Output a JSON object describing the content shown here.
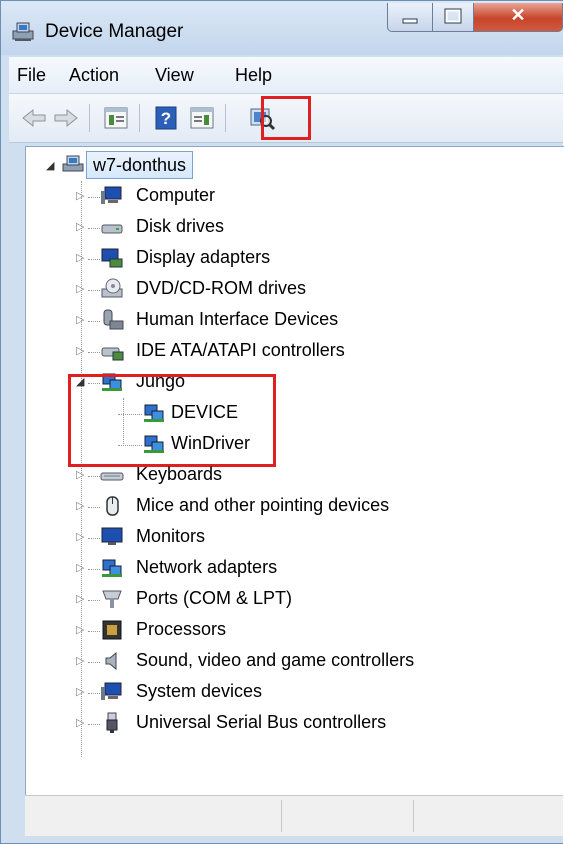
{
  "window": {
    "title": "Device Manager"
  },
  "title_controls": {
    "minimize": "minimize",
    "maximize": "maximize",
    "close": "close"
  },
  "menu": [
    "File",
    "Action",
    "View",
    "Help"
  ],
  "toolbar": [
    "back-arrow-icon",
    "forward-arrow-icon",
    "properties-icon",
    "help-icon",
    "show-hide-icon",
    "scan-hardware-icon"
  ],
  "tree": {
    "root": "w7-donthus",
    "items": [
      {
        "label": "Computer",
        "icon": "computer-icon",
        "expanded": false
      },
      {
        "label": "Disk drives",
        "icon": "disk-drive-icon",
        "expanded": false
      },
      {
        "label": "Display adapters",
        "icon": "display-adapter-icon",
        "expanded": false
      },
      {
        "label": "DVD/CD-ROM drives",
        "icon": "dvd-drive-icon",
        "expanded": false
      },
      {
        "label": "Human Interface Devices",
        "icon": "hid-icon",
        "expanded": false
      },
      {
        "label": "IDE ATA/ATAPI controllers",
        "icon": "ide-controller-icon",
        "expanded": false
      },
      {
        "label": "Jungo",
        "icon": "network-device-icon",
        "expanded": true,
        "children": [
          {
            "label": "DEVICE",
            "icon": "network-device-icon"
          },
          {
            "label": "WinDriver",
            "icon": "network-device-icon"
          }
        ]
      },
      {
        "label": "Keyboards",
        "icon": "keyboard-icon",
        "expanded": false
      },
      {
        "label": "Mice and other pointing devices",
        "icon": "mouse-icon",
        "expanded": false
      },
      {
        "label": "Monitors",
        "icon": "monitor-icon",
        "expanded": false
      },
      {
        "label": "Network adapters",
        "icon": "network-adapter-icon",
        "expanded": false
      },
      {
        "label": "Ports (COM & LPT)",
        "icon": "port-icon",
        "expanded": false
      },
      {
        "label": "Processors",
        "icon": "processor-icon",
        "expanded": false
      },
      {
        "label": "Sound, video and game controllers",
        "icon": "speaker-icon",
        "expanded": false
      },
      {
        "label": "System devices",
        "icon": "system-device-icon",
        "expanded": false
      },
      {
        "label": "Universal Serial Bus controllers",
        "icon": "usb-icon",
        "expanded": false
      }
    ]
  },
  "colors": {
    "highlight": "#e02020",
    "selection_bg": "#d6e8fb",
    "window_frame": "#cfdff0"
  }
}
